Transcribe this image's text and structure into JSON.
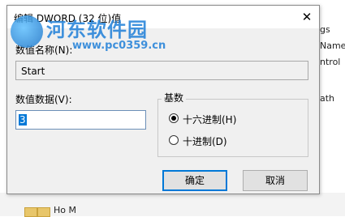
{
  "background": {
    "right_texts": [
      "gs",
      "Name",
      "ntrol",
      "ath"
    ],
    "bottom_text": "Ho M"
  },
  "watermark": {
    "text": "河东软件园",
    "url": "www.pc0359.cn"
  },
  "dialog": {
    "title": "编辑 DWORD (32 位)值",
    "close_icon": "close-icon",
    "value_name_label": "数值名称(N):",
    "value_name": "Start",
    "value_data_label": "数值数据(V):",
    "value_data": "3",
    "base_group_title": "基数",
    "radio_hex_label": "十六进制(H)",
    "radio_dec_label": "十进制(D)",
    "selected_base": "hex",
    "ok_label": "确定",
    "cancel_label": "取消"
  }
}
